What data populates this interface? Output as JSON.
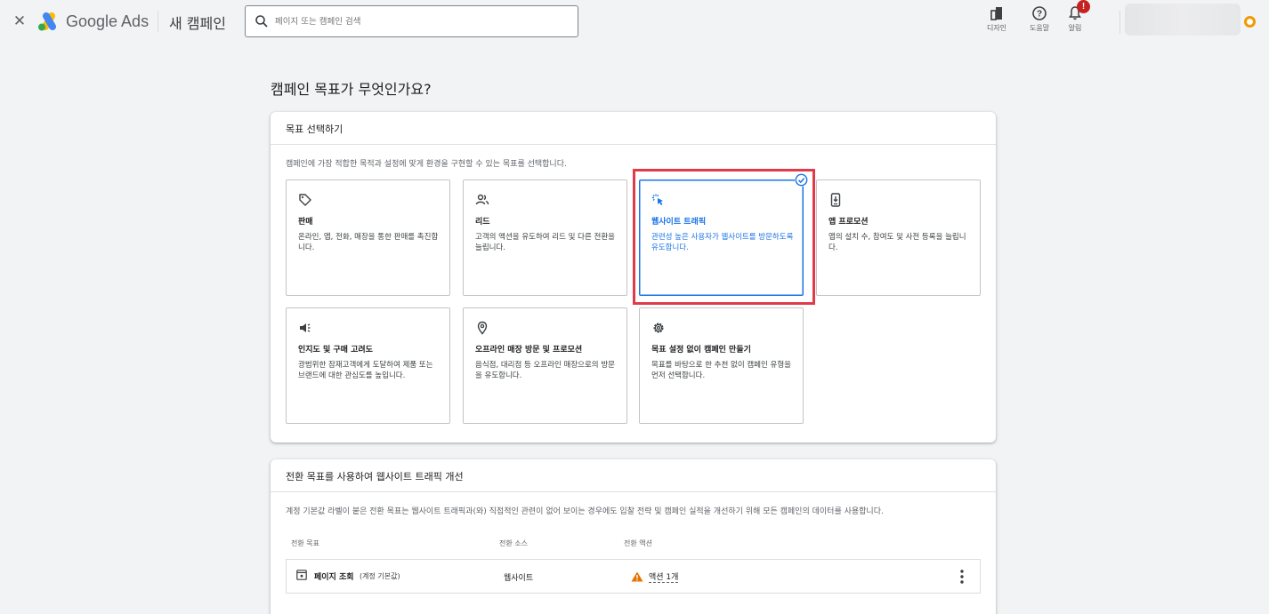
{
  "topbar": {
    "close_icon": "close-icon",
    "brand": "Google Ads",
    "campaign_title": "새 캠페인",
    "search_placeholder": "페이지 또는 캠페인 검색",
    "tools": [
      {
        "label": "디자인",
        "icon": "design-icon"
      },
      {
        "label": "도움말",
        "icon": "help-icon"
      },
      {
        "label": "알림",
        "icon": "bell-icon",
        "badge": "!"
      }
    ]
  },
  "main": {
    "heading": "캠페인 목표가 무엇인가요?",
    "goal_card": {
      "title": "목표 선택하기",
      "description": "캠페인에 가장 적합한 목적과 설정에 맞게 환경을 구현할 수 있는 목표를 선택합니다.",
      "selected_index": 2,
      "goals": [
        {
          "icon": "tag-icon",
          "title": "판매",
          "desc": "온라인, 앱, 전화, 매장을 통한 판매를 촉진합니다."
        },
        {
          "icon": "people-icon",
          "title": "리드",
          "desc": "고객의 액션을 유도하여 리드 및 다른 전환을 늘립니다."
        },
        {
          "icon": "cursor-click-icon",
          "title": "웹사이트 트래픽",
          "desc": "관련성 높은 사용자가 웹사이트를 방문하도록 유도합니다."
        },
        {
          "icon": "phone-icon",
          "title": "앱 프로모션",
          "desc": "앱의 설치 수, 참여도 및 사전 등록을 늘립니다."
        },
        {
          "icon": "megaphone-icon",
          "title": "인지도 및 구매 고려도",
          "desc": "광범위한 잠재고객에게 도달하여 제품 또는 브랜드에 대한 관심도를 높입니다."
        },
        {
          "icon": "location-pin-icon",
          "title": "오프라인 매장 방문 및 프로모션",
          "desc": "음식점, 대리점 등 오프라인 매장으로의 방문을 유도합니다."
        },
        {
          "icon": "gear-icon",
          "title": "목표 설정 없이 캠페인 만들기",
          "desc": "목표를 바탕으로 한 추천 없이 캠페인 유형을 먼저 선택합니다."
        }
      ]
    },
    "conversion_card": {
      "title": "전환 목표를 사용하여 웹사이트 트래픽 개선",
      "description": "계정 기본값 라벨이 붙은 전환 목표는 웹사이트 트래픽과(와) 직접적인 관련이 없어 보이는 경우에도 입찰 전략 및 캠페인 실적을 개선하기 위해 모든 캠페인의 데이터를 사용합니다.",
      "columns": [
        "전환 목표",
        "전환 소스",
        "전환 액션"
      ],
      "rows": [
        {
          "goal": "페이지 조회",
          "goal_sub": "(계정 기본값)",
          "source": "웹사이트",
          "action": "액션 1개"
        }
      ]
    }
  },
  "colors": {
    "accent": "#1a73e8",
    "highlight": "#e03b4b",
    "warning": "#e37400"
  }
}
